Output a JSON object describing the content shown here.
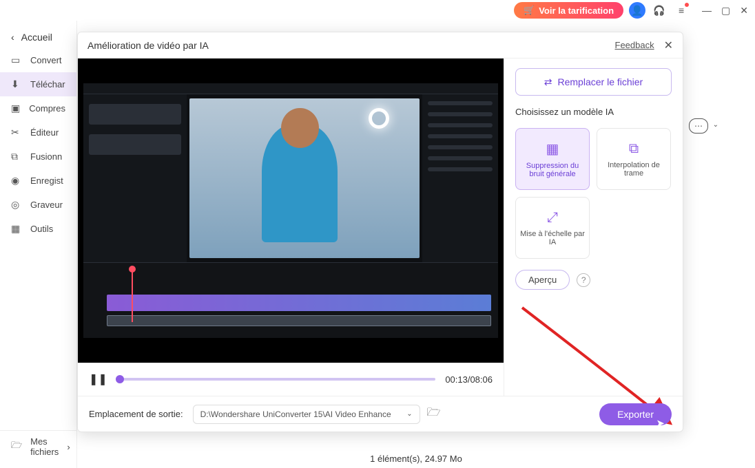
{
  "titlebar": {
    "pricing_label": "Voir la tarification"
  },
  "sidebar": {
    "back_label": "Accueil",
    "items": [
      {
        "label": "Convert"
      },
      {
        "label": "Téléchar"
      },
      {
        "label": "Compres"
      },
      {
        "label": "Éditeur"
      },
      {
        "label": "Fusionn"
      },
      {
        "label": "Enregist"
      },
      {
        "label": "Graveur"
      },
      {
        "label": "Outils"
      }
    ],
    "files_label": "Mes fichiers"
  },
  "modal": {
    "title": "Amélioration de vidéo par IA",
    "feedback": "Feedback",
    "time": "00:13/08:06",
    "replace_label": "Remplacer le fichier",
    "model_label": "Choisissez un modèle IA",
    "cards": [
      {
        "label": "Suppression du bruit générale"
      },
      {
        "label": "Interpolation de trame"
      },
      {
        "label": "Mise à l'échelle par IA"
      }
    ],
    "apercu": "Aperçu",
    "output_label": "Emplacement de sortie:",
    "output_path": "D:\\Wondershare UniConverter 15\\AI Video Enhance",
    "export_label": "Exporter"
  },
  "status": "1 élément(s), 24.97 Mo"
}
